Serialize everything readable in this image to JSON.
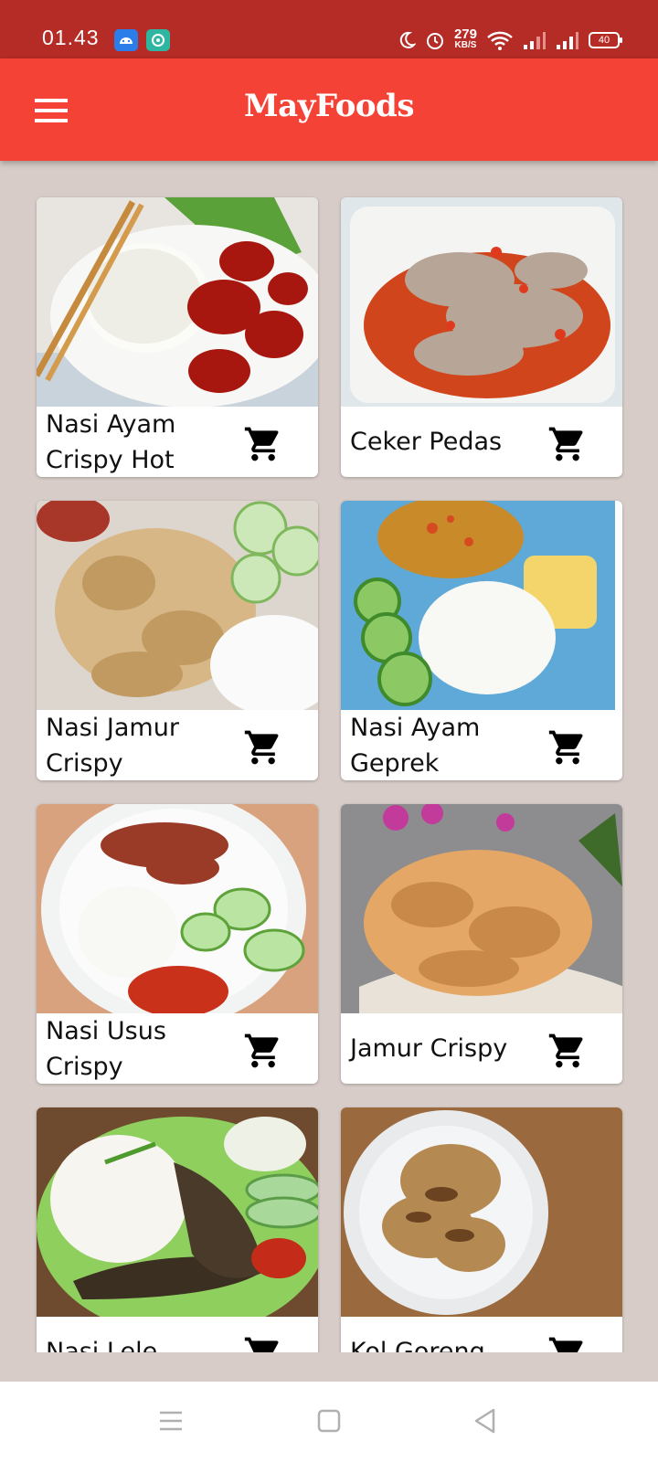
{
  "status_bar": {
    "time": "01.43",
    "net_speed_value": "279",
    "net_speed_unit": "KB/S",
    "battery": "40"
  },
  "app_bar": {
    "title": "MayFoods",
    "color": "#f44336",
    "icon": "menu-icon"
  },
  "menu_items": [
    {
      "name": "Nasi Ayam Crispy Hot",
      "icon": "cart-icon"
    },
    {
      "name": "Ceker Pedas",
      "icon": "cart-icon"
    },
    {
      "name": "Nasi Jamur Crispy",
      "icon": "cart-icon"
    },
    {
      "name": "Nasi Ayam Geprek",
      "icon": "cart-icon"
    },
    {
      "name": "Nasi Usus Crispy",
      "icon": "cart-icon"
    },
    {
      "name": "Jamur Crispy",
      "icon": "cart-icon"
    },
    {
      "name": "Nasi Lele",
      "icon": "cart-icon"
    },
    {
      "name": "Kol Goreng",
      "icon": "cart-icon"
    }
  ],
  "nav_bar": {
    "buttons": [
      "menu-icon",
      "home-icon",
      "back-icon"
    ]
  }
}
